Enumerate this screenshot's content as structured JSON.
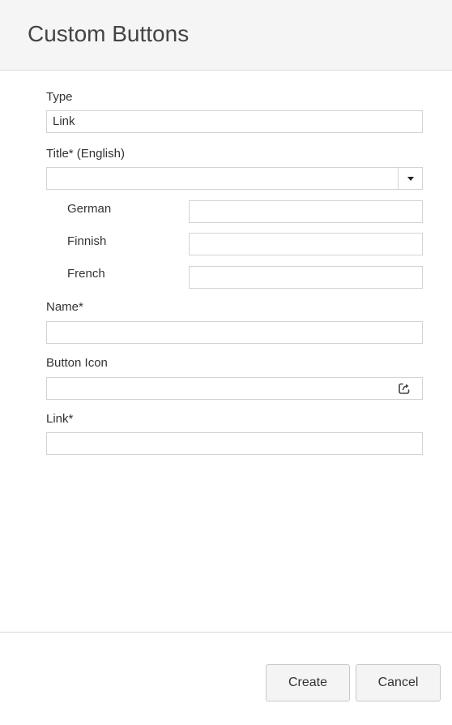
{
  "header": {
    "title": "Custom Buttons"
  },
  "form": {
    "type": {
      "label": "Type",
      "value": "Link"
    },
    "title": {
      "label": "Title* (English)",
      "value": ""
    },
    "translations": [
      {
        "language": "German",
        "value": ""
      },
      {
        "language": "Finnish",
        "value": ""
      },
      {
        "language": "French",
        "value": ""
      }
    ],
    "name": {
      "label": "Name*",
      "value": ""
    },
    "button_icon": {
      "label": "Button Icon",
      "value": "",
      "icon": "external-link-icon"
    },
    "link": {
      "label": "Link*",
      "value": ""
    }
  },
  "footer": {
    "create_label": "Create",
    "cancel_label": "Cancel"
  }
}
